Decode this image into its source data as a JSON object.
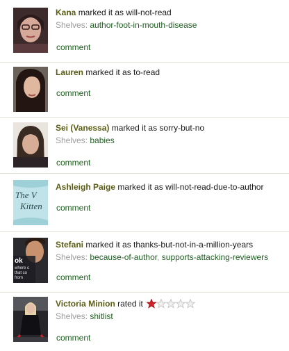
{
  "shelves_label": "Shelves:",
  "comment_label": "comment",
  "entries": [
    {
      "user": "Kana",
      "action": "marked it as will-not-read",
      "shelves": [
        "author-foot-in-mouth-disease"
      ]
    },
    {
      "user": "Lauren",
      "action": "marked it as to-read",
      "shelves": []
    },
    {
      "user": "Sei (Vanessa)",
      "action": "marked it as sorry-but-no",
      "shelves": [
        "babies"
      ]
    },
    {
      "user": "Ashleigh Paige",
      "action": "marked it as will-not-read-due-to-author",
      "shelves": [],
      "avatar_text": [
        "The V",
        "Kitten"
      ]
    },
    {
      "user": "Stefani",
      "action": "marked it as thanks-but-not-in-a-million-years",
      "shelves": [
        "because-of-author",
        "supports-attacking-reviewers"
      ],
      "avatar_text": [
        "ok",
        "where c",
        "that co",
        "from"
      ]
    },
    {
      "user": "Victoria Minion",
      "action": "rated it",
      "shelves": [
        "shitlist"
      ],
      "rating": 1,
      "rating_max": 5
    }
  ],
  "colors": {
    "username": "#5a5d13",
    "link": "#1f5e21",
    "muted": "#9b9b9b",
    "star_filled": "#d3222a",
    "star_empty": "#c8c8c8",
    "divider": "#e3e1d6"
  },
  "icons": {
    "star_filled": "star-filled-icon",
    "star_empty": "star-empty-icon"
  }
}
